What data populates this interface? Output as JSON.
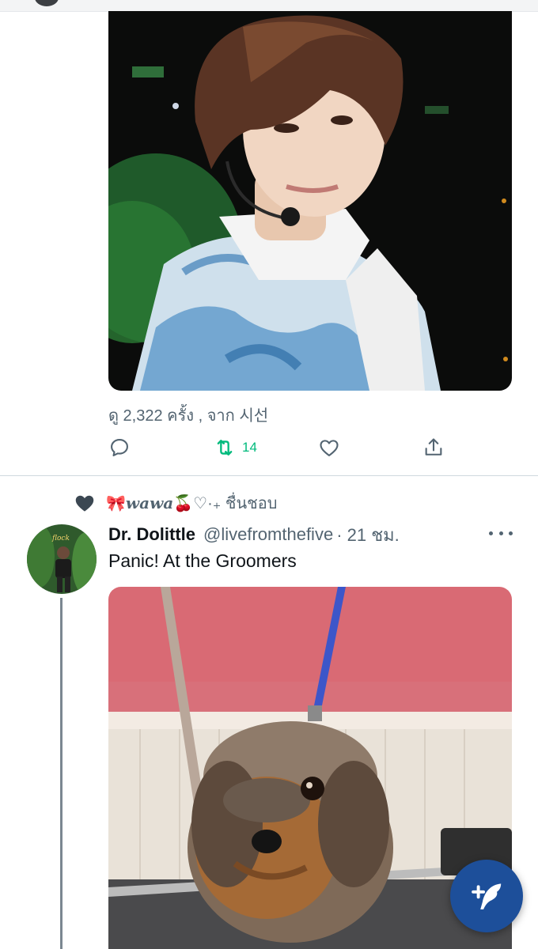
{
  "tweet1": {
    "views_text": "ดู 2,322 ครั้ง , จาก 시선",
    "actions": {
      "reply_icon": "reply-icon",
      "retweet_icon": "retweet-icon",
      "retweet_count": "14",
      "like_icon": "heart-icon",
      "share_icon": "share-icon"
    }
  },
  "tweet2": {
    "liked_by_prefix": "🎀",
    "liked_by_name": "wawa",
    "liked_by_suffix": "🍒♡·₊ ชื่นชอบ",
    "author_name": "Dr. Dolittle",
    "author_handle": "@livefromthefive",
    "timestamp": "· 21 ชม.",
    "text": "Panic! At the Groomers"
  },
  "compose": {
    "icon": "compose-feather-icon"
  },
  "colors": {
    "accent_green": "#00ba7c",
    "fab_blue": "#1d4f9a",
    "muted": "#536471"
  }
}
